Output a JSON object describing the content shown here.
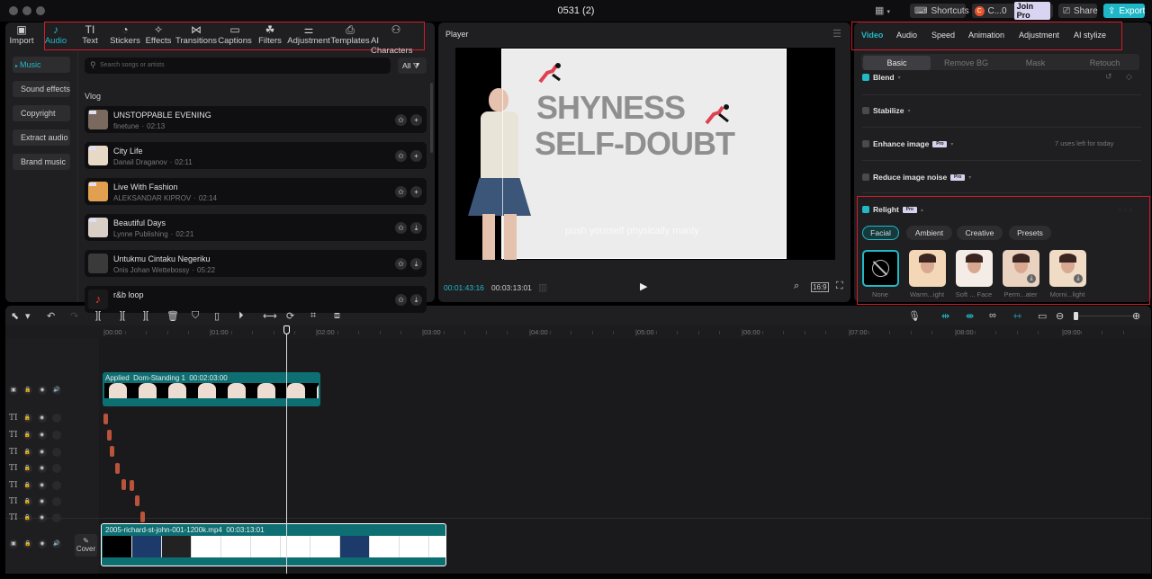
{
  "window": {
    "title": "0531 (2)"
  },
  "topbar": {
    "layout_icon": "layout-icon",
    "shortcuts": "Shortcuts",
    "account": {
      "initial": "C",
      "name": "C...0"
    },
    "join_pro": "Join Pro",
    "share": "Share",
    "export": "Export"
  },
  "media_toolbar": [
    {
      "label": "Import",
      "icon": "import-icon",
      "glyph": "▣"
    },
    {
      "label": "Audio",
      "icon": "audio-icon",
      "glyph": "♪",
      "active": true
    },
    {
      "label": "Text",
      "icon": "text-icon",
      "glyph": "TI"
    },
    {
      "label": "Stickers",
      "icon": "stickers-icon",
      "glyph": "◔"
    },
    {
      "label": "Effects",
      "icon": "effects-icon",
      "glyph": "✧"
    },
    {
      "label": "Transitions",
      "icon": "transitions-icon",
      "glyph": "⋈"
    },
    {
      "label": "Captions",
      "icon": "captions-icon",
      "glyph": "▭"
    },
    {
      "label": "Filters",
      "icon": "filters-icon",
      "glyph": "☘"
    },
    {
      "label": "Adjustment",
      "icon": "adjustment-icon",
      "glyph": "⚌"
    },
    {
      "label": "Templates",
      "icon": "templates-icon",
      "glyph": "⎙"
    },
    {
      "label": "AI Characters",
      "icon": "ai-characters-icon",
      "glyph": "⚇"
    }
  ],
  "audio_sidebar": [
    {
      "label": "Music",
      "active": true
    },
    {
      "label": "Sound effects"
    },
    {
      "label": "Copyright"
    },
    {
      "label": "Extract audio"
    },
    {
      "label": "Brand music"
    }
  ],
  "music": {
    "search_placeholder": "Search songs or artists",
    "filter_label": "All",
    "section": "Vlog",
    "tracks": [
      {
        "title": "UNSTOPPABLE EVENING",
        "artist": "finetune",
        "duration": "02:13",
        "action": "+",
        "pro": true
      },
      {
        "title": "City Life",
        "artist": "Danail Draganov",
        "duration": "02:11",
        "action": "+",
        "pro": true
      },
      {
        "title": "Live With Fashion",
        "artist": "ALEKSANDAR KIPROV",
        "duration": "02:14",
        "action": "+",
        "pro": true
      },
      {
        "title": "Beautiful Days",
        "artist": "Lynne Publishing",
        "duration": "02:21",
        "action": "⤓",
        "pro": true
      },
      {
        "title": "Untukmu Cintaku Negeriku",
        "artist": "Onis Johan Wettebossy",
        "duration": "05:22",
        "action": "⤓",
        "pro": false
      },
      {
        "title": "r&b loop",
        "artist": "",
        "duration": "",
        "action": "⤓",
        "pro": false
      }
    ],
    "dot": "·"
  },
  "player": {
    "title": "Player",
    "video_text": {
      "line1": "SHYNESS",
      "line2": "SELF-DOUBT",
      "caption": "push yourself physically manly"
    },
    "current_time": "00:01:43:16",
    "total_time": "00:03:13:01",
    "ratio": "16:9"
  },
  "inspector": {
    "tabs": [
      "Video",
      "Audio",
      "Speed",
      "Animation",
      "Adjustment",
      "AI stylize"
    ],
    "active_tab": "Video",
    "subtabs": [
      "Basic",
      "Remove BG",
      "Mask",
      "Retouch"
    ],
    "active_subtab": "Basic",
    "rows": [
      {
        "label": "Blend",
        "checked": true
      },
      {
        "label": "Stabilize",
        "checked": false
      },
      {
        "label": "Enhance image",
        "checked": false,
        "pro": true,
        "note": "7 uses left for today"
      },
      {
        "label": "Reduce image noise",
        "checked": false,
        "pro": true
      }
    ],
    "pro_badge": "Pro",
    "relight": {
      "label": "Relight",
      "checked": true,
      "categories": [
        "Facial",
        "Ambient",
        "Creative",
        "Presets"
      ],
      "active_category": "Facial",
      "presets": [
        "None",
        "Warm...ight",
        "Soft ... Face",
        "Perm...ater",
        "Morni...light"
      ]
    }
  },
  "timeline": {
    "ticks": [
      "|00:00",
      "|01:00",
      "|02:00",
      "|03:00",
      "|04:00",
      "|05:00",
      "|06:00",
      "|07:00",
      "|08:00",
      "|09:00"
    ],
    "overlay_clip": {
      "tag": "Applied",
      "name": "Dom-Standing 1",
      "duration": "00:02:03:00"
    },
    "main_clip": {
      "name": "2005-richard-st-john-001-1200k.mp4",
      "duration": "00:03:13:01"
    },
    "cover_label": "Cover",
    "text_track_glyph": "TI",
    "playhead_progress": 0.537
  },
  "colors": {
    "accent": "#22b8c6",
    "clip_teal": "#0e6f73",
    "text_clip": "#b9533a",
    "highlight_red": "#d21c2a"
  }
}
